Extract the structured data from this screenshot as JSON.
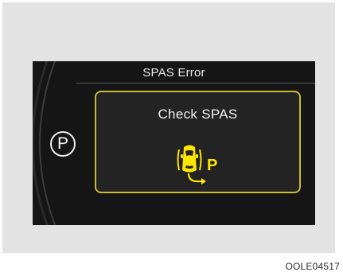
{
  "display": {
    "header_title": "SPAS Error",
    "gear": "P",
    "warning": {
      "message": "Check SPAS",
      "icon": "spas-parking-assist-icon",
      "icon_label": "P"
    }
  },
  "caption": "OOLE04517",
  "colors": {
    "background_panel": "#e3e3e3",
    "screen": "#151515",
    "warning_border": "#c8bb33",
    "warning_icon": "#ffe600",
    "text": "#f0f0f0"
  }
}
